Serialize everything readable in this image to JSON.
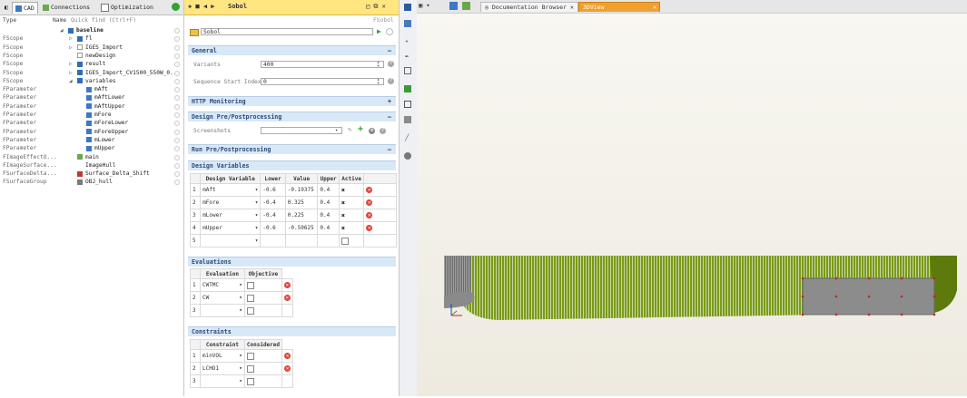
{
  "left": {
    "tabs": [
      "CAD",
      "Connections",
      "Optimization"
    ],
    "columns": {
      "type": "Type",
      "name": "Name",
      "quick_find": "Quick find (Ctrl+F)"
    },
    "rows": [
      {
        "type": "",
        "name": "baseline",
        "indent": 0,
        "arrow": "◢",
        "icon": "folder"
      },
      {
        "type": "FScope",
        "name": "fl",
        "indent": 1,
        "arrow": "▷",
        "icon": "folder"
      },
      {
        "type": "FScope",
        "name": "IGES_Import",
        "indent": 1,
        "arrow": "▷",
        "icon": "file"
      },
      {
        "type": "FScope",
        "name": "newDesign",
        "indent": 1,
        "arrow": "",
        "icon": "file"
      },
      {
        "type": "FScope",
        "name": "result",
        "indent": 1,
        "arrow": "▷",
        "icon": "folder"
      },
      {
        "type": "FScope",
        "name": "IGES_Import_CV1500_550W_0...",
        "indent": 1,
        "arrow": "▷",
        "icon": "folder"
      },
      {
        "type": "FScope",
        "name": "variables",
        "indent": 1,
        "arrow": "◢",
        "icon": "folder"
      },
      {
        "type": "FParameter",
        "name": "mAft",
        "indent": 2,
        "arrow": "",
        "icon": "param"
      },
      {
        "type": "FParameter",
        "name": "mAftLower",
        "indent": 2,
        "arrow": "",
        "icon": "param"
      },
      {
        "type": "FParameter",
        "name": "mAftUpper",
        "indent": 2,
        "arrow": "",
        "icon": "param"
      },
      {
        "type": "FParameter",
        "name": "mFore",
        "indent": 2,
        "arrow": "",
        "icon": "param"
      },
      {
        "type": "FParameter",
        "name": "mForeLower",
        "indent": 2,
        "arrow": "",
        "icon": "param"
      },
      {
        "type": "FParameter",
        "name": "mForeUpper",
        "indent": 2,
        "arrow": "",
        "icon": "param"
      },
      {
        "type": "FParameter",
        "name": "mLower",
        "indent": 2,
        "arrow": "",
        "icon": "param"
      },
      {
        "type": "FParameter",
        "name": "mUpper",
        "indent": 2,
        "arrow": "",
        "icon": "param"
      },
      {
        "type": "FImageEffectO...",
        "name": "main",
        "indent": 1,
        "arrow": "",
        "icon": "check"
      },
      {
        "type": "FImageSurface...",
        "name": "ImageHull",
        "indent": 1,
        "arrow": "",
        "icon": "none"
      },
      {
        "type": "FSurfaceDelta...",
        "name": "Surface_Delta_Shift",
        "indent": 1,
        "arrow": "",
        "icon": "surf"
      },
      {
        "type": "FSurfaceGroup",
        "name": "OBJ_hull",
        "indent": 1,
        "arrow": "",
        "icon": "group"
      }
    ]
  },
  "mid": {
    "tab_title": "Sobol",
    "tab_type": "FSobol",
    "name_value": "Sobol",
    "sections": {
      "general": "General",
      "http": "HTTP Monitoring",
      "design_pp": "Design Pre/Postprocessing",
      "run_pp": "Run Pre/Postprocessing",
      "design_vars": "Design Variables",
      "evaluations": "Evaluations",
      "constraints": "Constraints"
    },
    "variants_label": "Variants",
    "variants_value": "400",
    "seq_label": "Sequence Start Index",
    "seq_value": "0",
    "screenshots_label": "Screenshots",
    "dv_headers": [
      "",
      "Design Variable",
      "Lower",
      "Value",
      "Upper",
      "Active",
      ""
    ],
    "dv_rows": [
      {
        "idx": "1",
        "name": "mAft",
        "lower": "-0.6",
        "value": "-0.19375",
        "upper": "0.4"
      },
      {
        "idx": "2",
        "name": "mFore",
        "lower": "-0.4",
        "value": "0.325",
        "upper": "0.4"
      },
      {
        "idx": "3",
        "name": "mLower",
        "lower": "-0.4",
        "value": "0.225",
        "upper": "0.4"
      },
      {
        "idx": "4",
        "name": "mUpper",
        "lower": "-0.6",
        "value": "-0.50625",
        "upper": "0.4"
      },
      {
        "idx": "5",
        "name": "",
        "lower": "",
        "value": "",
        "upper": ""
      }
    ],
    "ev_headers": [
      "",
      "Evaluation",
      "Objective"
    ],
    "ev_rows": [
      {
        "idx": "1",
        "name": "CWTMC"
      },
      {
        "idx": "2",
        "name": "CW"
      },
      {
        "idx": "3",
        "name": ""
      }
    ],
    "con_headers": [
      "",
      "Constraint",
      "Considered"
    ],
    "con_rows": [
      {
        "idx": "1",
        "name": "minVOL"
      },
      {
        "idx": "2",
        "name": "LCHO1"
      },
      {
        "idx": "3",
        "name": ""
      }
    ]
  },
  "right": {
    "tabs": [
      "Documentation Browser",
      "3DView"
    ]
  },
  "colors": {
    "hull_green": "#5e7a0c",
    "tab_yellow": "#ffe680",
    "section_blue": "#d8e8f7",
    "active_tab_orange": "#f0a030"
  }
}
